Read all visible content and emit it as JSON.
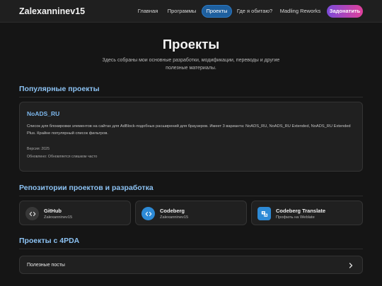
{
  "header": {
    "brand": "Zalexanninev15",
    "nav": [
      {
        "label": "Главная"
      },
      {
        "label": "Программы"
      },
      {
        "label": "Проекты",
        "active": true
      },
      {
        "label": "Где я обитаю?"
      },
      {
        "label": "Madling Reworks"
      }
    ],
    "donate_label": "Задонатить"
  },
  "hero": {
    "title": "Проекты",
    "subtitle": "Здесь собраны мои основные разработки, модификации, переводы и другие полезные материалы."
  },
  "popular": {
    "section_title": "Популярные проекты",
    "project": {
      "title": "NoADS_RU",
      "description": "Список для блокировки элементов на сайтах для AdBlock-подобных расширений для браузеров. Имеет 3 варианта: NoADS_RU, NoADS_RU Extended, NoADS_RU Extended Plus. Крайне популярный список фильтров.",
      "version": "Версия: 2025",
      "updated": "Обновлено: Обновляется слишком часто"
    }
  },
  "repos": {
    "section_title": "Репозитории проектов и разработка",
    "items": [
      {
        "title": "GitHub",
        "subtitle": "Zalexanninev15",
        "icon": "code-icon"
      },
      {
        "title": "Codeberg",
        "subtitle": "Zalexanninev15",
        "icon": "code-icon"
      },
      {
        "title": "Codeberg Translate",
        "subtitle": "Профиль на Weblate",
        "icon": "translate-icon"
      }
    ]
  },
  "fourpda": {
    "section_title": "Проекты с 4PDA",
    "items": [
      {
        "label": "Полезные посты"
      }
    ]
  },
  "colors": {
    "accent": "#8cc2f3",
    "active_nav": "#1e5f9e",
    "donate_gradient_start": "#7b4bd9",
    "donate_gradient_end": "#e0409b",
    "background": "#151515",
    "card": "#202020",
    "github_icon_bg": "#383838",
    "codeberg_icon_bg": "#2d8ad6",
    "translate_icon_bg": "#2d8ad6"
  }
}
